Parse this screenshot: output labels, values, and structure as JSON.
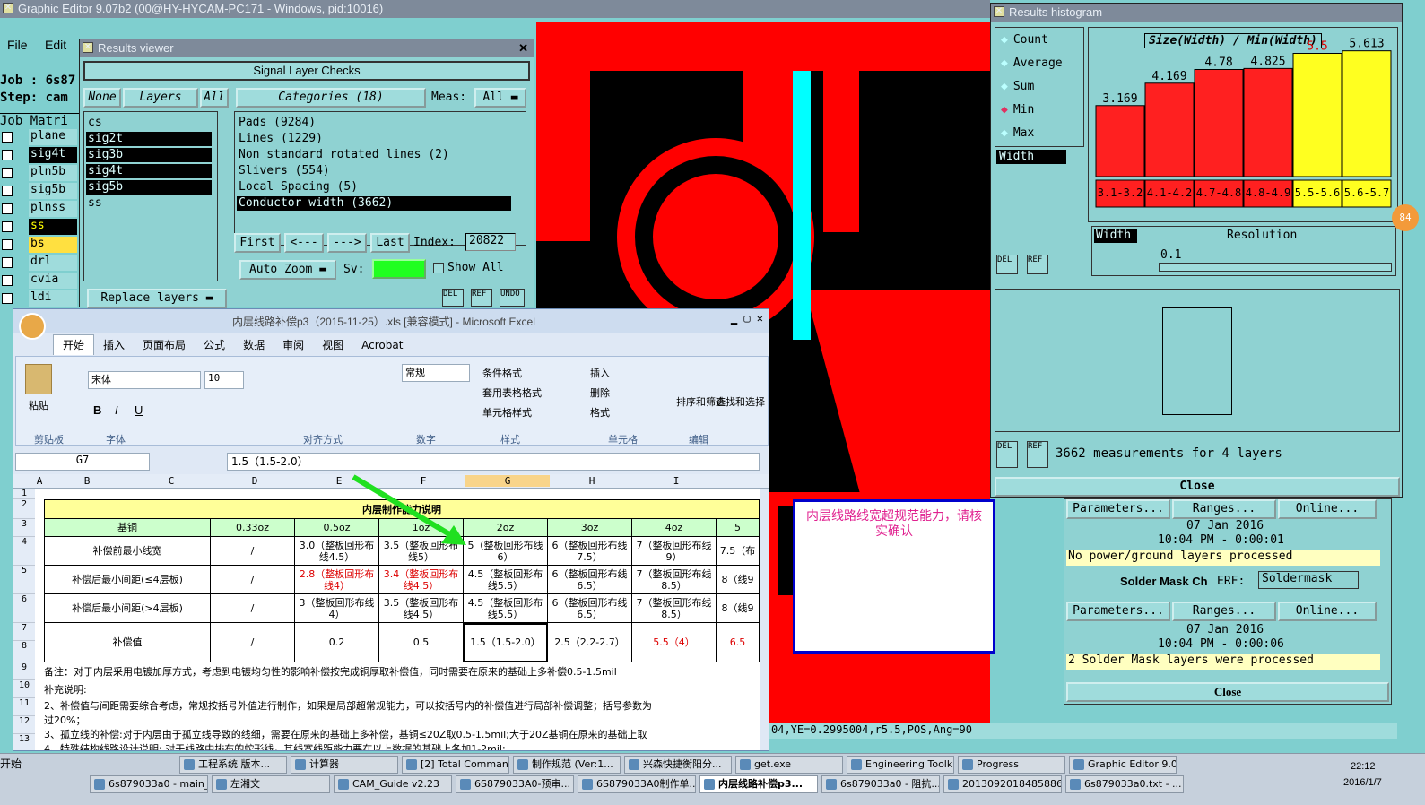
{
  "app": {
    "title": "Graphic Editor 9.07b2 (00@HY-HYCAM-PC171 - Windows, pid:10016)",
    "menu": [
      "File",
      "Edit"
    ],
    "job": "Job : 6s87",
    "step": "Step: cam",
    "job_matrix": "Job Matri",
    "layers": [
      "plane",
      "sig4t",
      "pln5b",
      "sig5b",
      "plnss",
      "ss",
      "bs",
      "drl",
      "cvia",
      "ldi"
    ]
  },
  "results_viewer": {
    "title": "Results viewer",
    "header": "Signal Layer Checks",
    "none_btn": "None",
    "layers_btn": "Layers",
    "all_btn": "All",
    "categories_btn": "Categories (18)",
    "meas_label": "Meas:",
    "meas_value": "All",
    "layer_list": [
      "cs",
      "sig2t",
      "sig3b",
      "sig4t",
      "sig5b",
      "ss"
    ],
    "categories": [
      "Pads (9284)",
      "Lines (1229)",
      "Non standard rotated lines (2)",
      "Slivers (554)",
      "Local Spacing (5)",
      "Conductor width (3662)"
    ],
    "first": "First",
    "prev": "<---",
    "next": "--->",
    "last": "Last",
    "index_label": "Index:",
    "index_value": "20822",
    "auto_zoom": "Auto Zoom",
    "sv_label": "Sv:",
    "show_all": "Show All",
    "replace_layers": "Replace layers",
    "del": "DEL",
    "ref": "REF",
    "undo": "UNDO"
  },
  "histogram": {
    "title": "Results histogram",
    "options": [
      "Count",
      "Average",
      "Sum",
      "Min",
      "Max"
    ],
    "selected": "Min",
    "field": "Width",
    "chart_title": "Size(Width) / Min(Width)",
    "resolution_label": "Resolution",
    "resolution_field": "Width",
    "resolution_value": "0.1",
    "measurements": "3662 measurements for 4 layers",
    "close": "Close",
    "del": "DEL",
    "ref": "REF",
    "badge": "84"
  },
  "chart_data": {
    "type": "bar",
    "title": "Size(Width) / Min(Width)",
    "categories": [
      "3.1-3.2",
      "4.1-4.2",
      "4.7-4.8",
      "4.8-4.9",
      "5.5-5.6",
      "5.6-5.7"
    ],
    "values": [
      3.169,
      4.169,
      4.78,
      4.825,
      5.5,
      5.613
    ],
    "value_labels": [
      "3.169",
      "4.169",
      "4.78",
      "4.825",
      "5.5",
      "5.613"
    ],
    "colors": [
      "#ff2020",
      "#ff2020",
      "#ff2020",
      "#ff2020",
      "#ffff20",
      "#ffff20"
    ],
    "label_colors": [
      "#000",
      "#000",
      "#000",
      "#000",
      "#d00",
      "#000"
    ],
    "ylim": [
      0,
      6
    ],
    "xlabel": "",
    "ylabel": ""
  },
  "excel": {
    "title": "内层线路补偿p3（2015-11-25）.xls  [兼容模式] - Microsoft Excel",
    "tabs": [
      "开始",
      "插入",
      "页面布局",
      "公式",
      "数据",
      "审阅",
      "视图",
      "Acrobat"
    ],
    "groups": [
      "剪贴板",
      "字体",
      "对齐方式",
      "数字",
      "样式",
      "单元格",
      "编辑"
    ],
    "font": "宋体",
    "size": "10",
    "number_format": "常规",
    "paste": "粘贴",
    "style_items": [
      "条件格式",
      "套用表格格式",
      "单元格样式"
    ],
    "cell_items": [
      "插入",
      "删除",
      "格式"
    ],
    "edit_items": [
      "排序和筛选",
      "查找和选择"
    ],
    "cell_ref": "G7",
    "formula": "1.5（1.5-2.0）",
    "cols": [
      "A",
      "B",
      "C",
      "D",
      "E",
      "F",
      "G",
      "H",
      "I"
    ],
    "rows": [
      "1",
      "2",
      "3",
      "4",
      "5",
      "6",
      "7",
      "8",
      "9",
      "10",
      "11",
      "12",
      "13"
    ],
    "table_title": "内层制作能力说明",
    "header": [
      "基铜",
      "0.33oz",
      "0.5oz",
      "1oz",
      "2oz",
      "3oz",
      "4oz",
      "5"
    ],
    "r4": [
      "补偿前最小线宽",
      "/",
      "3.0（整板回形布线4.5）",
      "3.5（整板回形布线5）",
      "5（整板回形布线6）",
      "6（整板回形布线7.5）",
      "7（整板回形布线9）",
      "7.5（布"
    ],
    "r5": [
      "补偿后最小间距(≤4层板)",
      "/",
      "2.8（整板回形布线4）",
      "3.4（整板回形布线4.5）",
      "4.5（整板回形布线5.5）",
      "6（整板回形布线6.5）",
      "7（整板回形布线8.5）",
      "8（线9"
    ],
    "r6": [
      "补偿后最小间距(>4层板)",
      "/",
      "3（整板回形布线4）",
      "3.5（整板回形布线4.5）",
      "4.5（整板回形布线5.5）",
      "6（整板回形布线6.5）",
      "7（整板回形布线8.5）",
      "8（线9"
    ],
    "r7": [
      "补偿值",
      "/",
      "0.2",
      "0.5",
      "1.5（1.5-2.0）",
      "2.5（2.2-2.7）",
      "5.5（4）",
      "6.5"
    ],
    "note9": "备注：对于内层采用电镀加厚方式，考虑到电镀均匀性的影响补偿按完成铜厚取补偿值，同时需要在原来的基础上多补偿0.5-1.5mil",
    "note10": "补充说明:",
    "note11": "2、补偿值与间距需要综合考虑，常规按括号外值进行制作，如果是局部超常规能力，可以按括号内的补偿值进行局部补偿调整；括号参数为",
    "note11b": "过20%；",
    "note12": "3、孤立线的补偿:对于内层由于孤立线导致的线细，需要在原来的基础上多补偿，基铜≤20Z取0.5-1.5mil;大于20Z基铜在原来的基础上取",
    "note13": "4、特殊结构线路设计说明: 对于线路中排布的蛇形线，其线宽线距能力要在以上数据的基础上各加1-2mil;"
  },
  "annotation": "内层线路线宽超规范能力，请核实确认",
  "right_panel": {
    "parameters": "Parameters...",
    "ranges": "Ranges...",
    "online": "Online...",
    "date": "07 Jan 2016",
    "time1": "10:04 PM - 0:00:01",
    "time2": "10:04 PM - 0:00:06",
    "msg1": "No power/ground layers processed",
    "check_name": "Solder Mask Ch",
    "erf": "ERF:",
    "erf_value": "Soldermask",
    "msg2": "2 Solder Mask layers were processed",
    "close": "Close"
  },
  "status": {
    "coords": "04,YE=0.2995004,r5.5,POS,Ang=90"
  },
  "taskbar": {
    "start": "开始",
    "row1": [
      "工程系统 版本...",
      "计算器",
      "[2] Total Comman...",
      "制作规范 (Ver:1...",
      "兴森快捷衡阳分...",
      "get.exe",
      "Engineering Toolki...",
      "Progress",
      "Graphic Editor 9.0..."
    ],
    "row2": [
      "6s879033a0 - main_qa",
      "左湘文",
      "CAM_Guide v2.23",
      "6S879033A0-预审...",
      "6S879033A0制作单...",
      "内层线路补偿p3...",
      "6s879033a0 - 阻抗...",
      "20130920184858865...",
      "6s879033a0.txt - ..."
    ],
    "clock": "22:12",
    "date": "2016/1/7"
  }
}
